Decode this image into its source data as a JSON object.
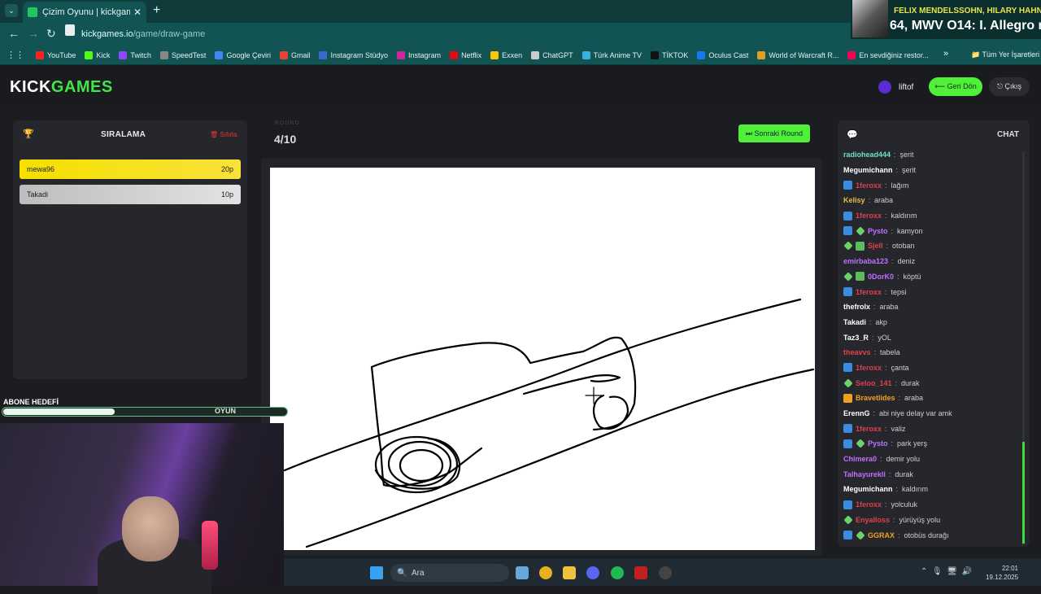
{
  "browser": {
    "tab_title": "Çizim Oyunu | kickgames.io",
    "tab_close": "✕",
    "new_tab": "+",
    "url_host": "kickgames.io",
    "url_path": "/game/draw-game",
    "bookmarks": [
      {
        "label": "YouTube",
        "color": "#ff2020"
      },
      {
        "label": "Kick",
        "color": "#53fc18"
      },
      {
        "label": "Twitch",
        "color": "#9146ff"
      },
      {
        "label": "SpeedTest",
        "color": "#888888"
      },
      {
        "label": "Google Çeviri",
        "color": "#4285f4"
      },
      {
        "label": "Gmail",
        "color": "#ea4335"
      },
      {
        "label": "Instagram Stüdyo",
        "color": "#3a6ad0"
      },
      {
        "label": "Instagram",
        "color": "#d6249f"
      },
      {
        "label": "Netflix",
        "color": "#e50914"
      },
      {
        "label": "Exxen",
        "color": "#f5c800"
      },
      {
        "label": "ChatGPT",
        "color": "#cccccc"
      },
      {
        "label": "Türk Anime TV",
        "color": "#3ab0e0"
      },
      {
        "label": "TİKTOK",
        "color": "#111111"
      },
      {
        "label": "Oculus Cast",
        "color": "#1877f2"
      },
      {
        "label": "World of Warcraft R...",
        "color": "#e0a020"
      },
      {
        "label": "En sevdiğiniz restor...",
        "color": "#fa0050"
      }
    ],
    "bookmarks_more": "»",
    "all_bookmarks": "Tüm Yer İşaretleri"
  },
  "now_playing": {
    "line1": "FELIX MENDELSSOHN, HILARY HAHN, H",
    "line2": "64, MWV O14: I. Allegro m"
  },
  "site": {
    "logo_kick": "KICK",
    "logo_games": "GAMES",
    "username": "liftof",
    "back_label": "⟵ Geri Dön",
    "logout_label": "⎋ Çıkış"
  },
  "ranking": {
    "title": "SIRALAMA",
    "reset_label": "🗑 Sıfırla",
    "players": [
      {
        "name": "mewa96",
        "score": "20p"
      },
      {
        "name": "Takadi",
        "score": "10p"
      }
    ]
  },
  "round": {
    "label": "ROUND",
    "value": "4/10",
    "next_label": "⏭ Sonraki Round"
  },
  "chat": {
    "title": "CHAT",
    "messages": [
      {
        "user": "radiohead444",
        "text": "şerit",
        "color": "#6ee0c8",
        "badges": []
      },
      {
        "user": "Megumichann",
        "text": "şerit",
        "color": "#ffffff",
        "badges": []
      },
      {
        "user": "1feroxx",
        "text": "lağım",
        "color": "#e0404c",
        "badges": [
          "blue"
        ]
      },
      {
        "user": "Kelisy",
        "text": "araba",
        "color": "#e0c040",
        "badges": []
      },
      {
        "user": "1feroxx",
        "text": "kaldırım",
        "color": "#e0404c",
        "badges": [
          "blue"
        ]
      },
      {
        "user": "Pysto",
        "text": "kamyon",
        "color": "#c070ff",
        "badges": [
          "blue",
          "green"
        ]
      },
      {
        "user": "Sjell",
        "text": "otoban",
        "color": "#e0404c",
        "badges": [
          "green",
          "gift"
        ]
      },
      {
        "user": "emirbaba123",
        "text": "deniz",
        "color": "#c070ff",
        "badges": []
      },
      {
        "user": "0DorK0",
        "text": "köptü",
        "color": "#c070ff",
        "badges": [
          "green",
          "gift"
        ]
      },
      {
        "user": "1feroxx",
        "text": "tepsi",
        "color": "#e0404c",
        "badges": [
          "blue"
        ]
      },
      {
        "user": "thefrolx",
        "text": "araba",
        "color": "#ffffff",
        "badges": []
      },
      {
        "user": "Takadi",
        "text": "akp",
        "color": "#ffffff",
        "badges": []
      },
      {
        "user": "Taz3_R",
        "text": "yOL",
        "color": "#ffffff",
        "badges": []
      },
      {
        "user": "theavvs",
        "text": "tabela",
        "color": "#e0404c",
        "badges": []
      },
      {
        "user": "1feroxx",
        "text": "çanta",
        "color": "#e0404c",
        "badges": [
          "blue"
        ]
      },
      {
        "user": "Seloo_141",
        "text": "durak",
        "color": "#e0404c",
        "badges": [
          "green"
        ]
      },
      {
        "user": "Bravetlides",
        "text": "araba",
        "color": "#f0a020",
        "badges": [
          "yellow"
        ]
      },
      {
        "user": "ErennG",
        "text": "abi niye delay var amk",
        "color": "#ffffff",
        "badges": []
      },
      {
        "user": "1feroxx",
        "text": "valiz",
        "color": "#e0404c",
        "badges": [
          "blue"
        ]
      },
      {
        "user": "Pysto",
        "text": "park yerş",
        "color": "#c070ff",
        "badges": [
          "blue",
          "green"
        ]
      },
      {
        "user": "Chimera0",
        "text": "demir yolu",
        "color": "#c070ff",
        "badges": []
      },
      {
        "user": "Talhayurekli",
        "text": "durak",
        "color": "#c070ff",
        "badges": []
      },
      {
        "user": "Megumichann",
        "text": "kaldırım",
        "color": "#ffffff",
        "badges": []
      },
      {
        "user": "1feroxx",
        "text": "yolculuk",
        "color": "#e0404c",
        "badges": [
          "blue"
        ]
      },
      {
        "user": "Enyalloss",
        "text": "yürüyüş yolu",
        "color": "#e0404c",
        "badges": [
          "green"
        ]
      },
      {
        "user": "GGRAX",
        "text": "otobüs durağı",
        "color": "#f0a020",
        "badges": [
          "blue",
          "green"
        ]
      }
    ]
  },
  "overlay": {
    "abone_label": "ABONE HEDEFİ",
    "abone_text": "OYUN",
    "abone_progress": 0.39
  },
  "taskbar": {
    "search_label": "Ara",
    "time": "22:01",
    "date": "19.12.2025"
  }
}
